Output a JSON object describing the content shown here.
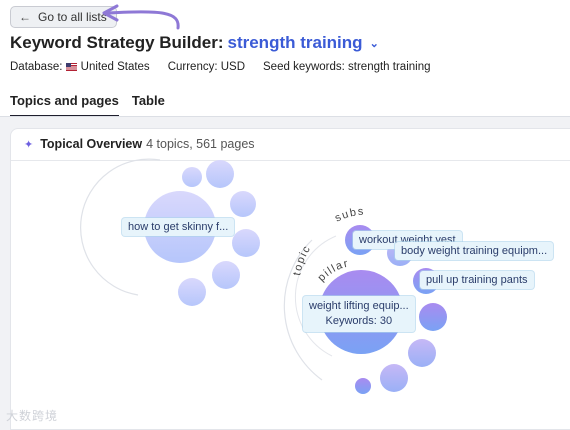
{
  "back_button": {
    "label": "Go to all lists"
  },
  "header": {
    "title_prefix": "Keyword Strategy Builder:",
    "title_keyword": "strength training"
  },
  "meta": {
    "database_label": "Database:",
    "database_value": "United States",
    "currency": "Currency: USD",
    "seed": "Seed keywords: strength training"
  },
  "tabs": [
    {
      "label": "Topics and pages",
      "active": true
    },
    {
      "label": "Table",
      "active": false
    }
  ],
  "overview": {
    "title": "Topical Overview",
    "count": "4 topics, 561 pages"
  },
  "graph": {
    "arc_labels": {
      "topic": "topic",
      "subs": "subs",
      "pillar": "pillar"
    },
    "cluster_1": {
      "label": "how to get skinny f..."
    },
    "cluster_2": {
      "pillar_label": "weight lifting equip...",
      "pillar_keywords": "Keywords: 30",
      "subs": [
        {
          "label": "workout weight vest"
        },
        {
          "label": "body weight training equipm..."
        },
        {
          "label": "pull up training pants"
        }
      ]
    }
  },
  "watermark": "大数跨境",
  "colors": {
    "accent": "#3b5bd6",
    "arrow": "#8e78d6",
    "bubble_light": "#c9cdfb",
    "bubble_dark": "#8f7ff0"
  }
}
